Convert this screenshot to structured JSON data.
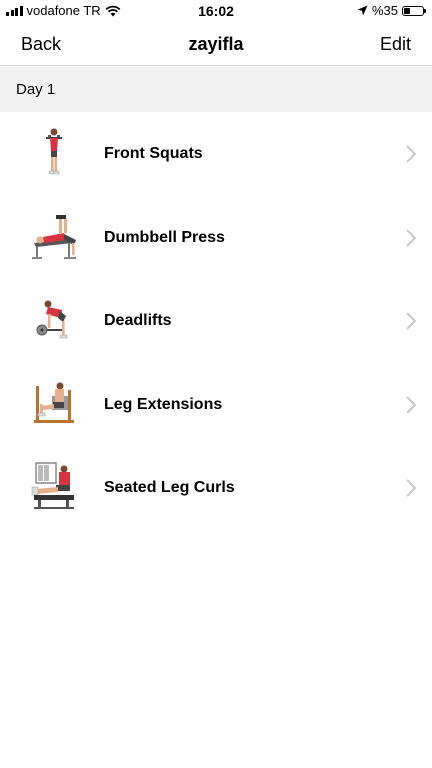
{
  "status_bar": {
    "carrier": "vodafone TR",
    "time": "16:02",
    "battery_text": "%35",
    "battery_level": 0.35,
    "icons": [
      "signal-icon",
      "wifi-icon",
      "location-arrow-icon",
      "battery-icon"
    ]
  },
  "nav": {
    "back_label": "Back",
    "title": "zayifla",
    "edit_label": "Edit"
  },
  "section": {
    "title": "Day 1"
  },
  "exercises": [
    {
      "name": "Front Squats",
      "icon": "front-squat-thumbnail"
    },
    {
      "name": "Dumbbell Press",
      "icon": "dumbbell-press-thumbnail"
    },
    {
      "name": "Deadlifts",
      "icon": "deadlift-thumbnail"
    },
    {
      "name": "Leg Extensions",
      "icon": "leg-extension-thumbnail"
    },
    {
      "name": "Seated Leg Curls",
      "icon": "seated-leg-curl-thumbnail"
    }
  ],
  "colors": {
    "accent_red": "#d8333f",
    "skin": "#e7b08c",
    "machine_gray": "#8a8a8a",
    "section_bg": "#f2f2f2",
    "chevron": "#c7c7cc"
  }
}
